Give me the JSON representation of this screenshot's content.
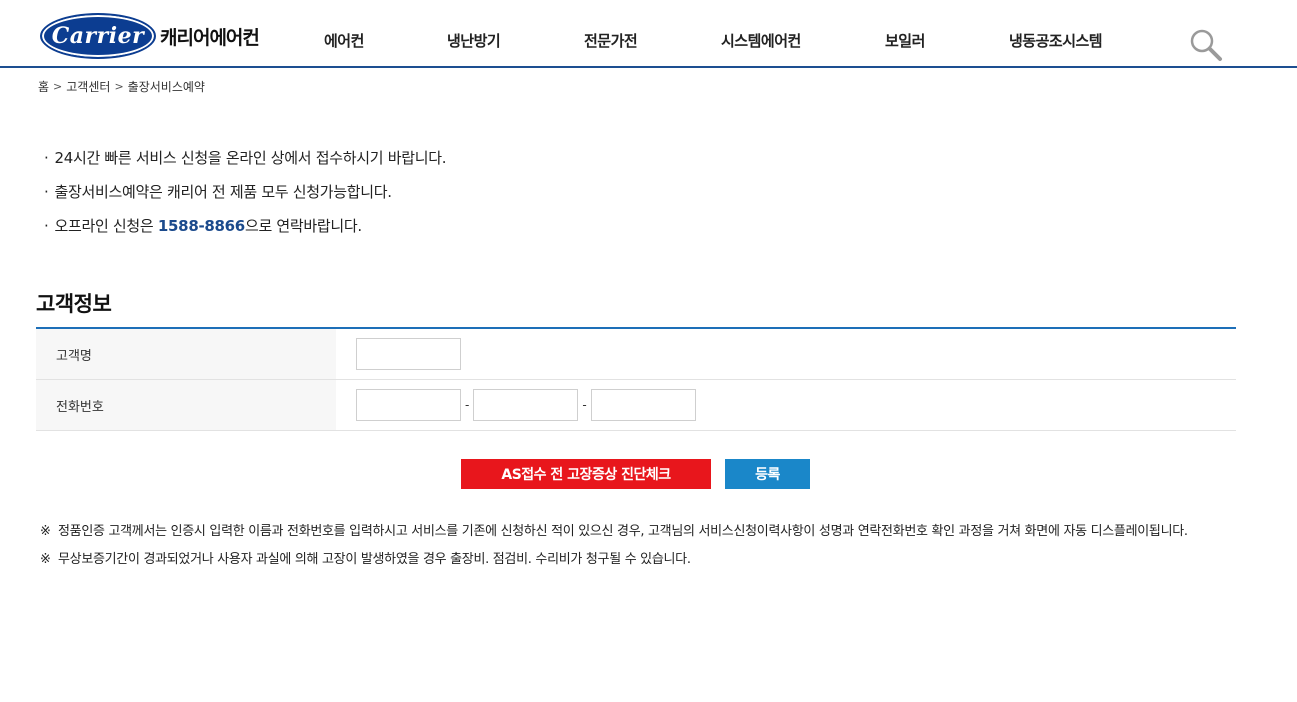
{
  "brand": {
    "logo_text": "Carrier",
    "company_name": "캐리어에어컨"
  },
  "nav": [
    {
      "label": "에어컨"
    },
    {
      "label": "냉난방기"
    },
    {
      "label": "전문가전"
    },
    {
      "label": "시스템에어컨"
    },
    {
      "label": "보일러"
    },
    {
      "label": "냉동공조시스템"
    }
  ],
  "search": {
    "icon": "search-icon"
  },
  "breadcrumb": {
    "items": [
      "홈",
      "고객센터",
      "출장서비스예약"
    ],
    "separator": ">"
  },
  "notice": {
    "line1": "24시간 빠른 서비스 신청을 온라인 상에서 접수하시기 바랍니다.",
    "line2": "출장서비스예약은 캐리어 전 제품 모두 신청가능합니다.",
    "line3_prefix": "오프라인 신청은 ",
    "line3_phone": "1588-8866",
    "line3_suffix": "으로 연락바랍니다.",
    "bullet": "·"
  },
  "customer_section": {
    "title": "고객정보",
    "name_label": "고객명",
    "name_value": "",
    "phone_label": "전화번호",
    "phone1": "",
    "phone2": "",
    "phone3": "",
    "phone_separator": "-"
  },
  "buttons": {
    "diagnosis": "AS접수 전 고장증상 진단체크",
    "register": "등록"
  },
  "remarks": {
    "mark": "※",
    "line1": "정품인증 고객께서는 인증시 입력한 이름과 전화번호를 입력하시고 서비스를 기존에 신청하신 적이 있으신 경우, 고객님의 서비스신청이력사항이 성명과 연락전화번호 확인 과정을 거쳐 화면에 자동 디스플레이됩니다.",
    "line2": "무상보증기간이 경과되었거나 사용자 과실에 의해 고장이 발생하였을 경우 출장비. 점검비. 수리비가 청구될 수 있습니다."
  },
  "colors": {
    "brand_blue": "#0c3d91",
    "header_line": "#1d4f91",
    "table_top_line": "#1d6fb8",
    "phone_blue": "#1b4a8c",
    "button_red": "#e8161c",
    "button_blue": "#1a87c9"
  }
}
